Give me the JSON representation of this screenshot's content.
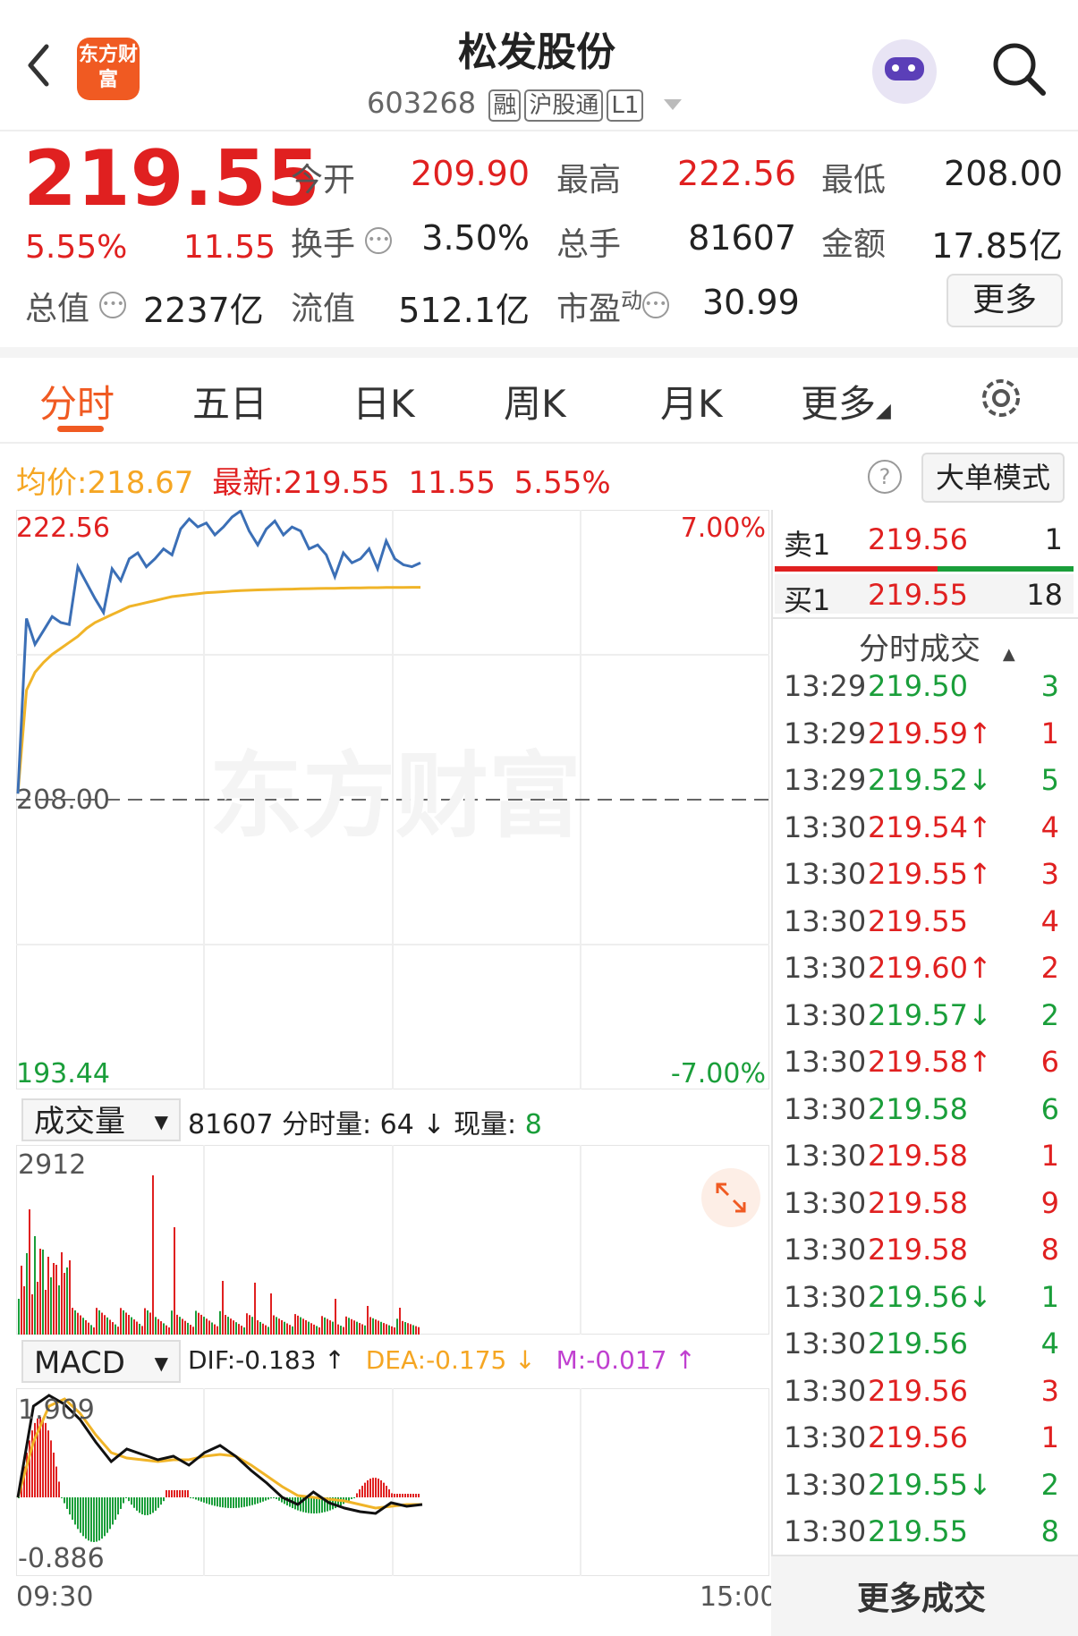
{
  "header": {
    "title": "松发股份",
    "code": "603268",
    "tags": [
      "融",
      "沪股通",
      "L1"
    ],
    "logo_text": "东方财富"
  },
  "quote": {
    "price": "219.55",
    "change_pct": "5.55%",
    "change": "11.55",
    "open_label": "今开",
    "open": "209.90",
    "high_label": "最高",
    "high": "222.56",
    "low_label": "最低",
    "low": "208.00",
    "turnover_label": "换手",
    "turnover": "3.50%",
    "volume_label": "总手",
    "volume": "81607",
    "amount_label": "金额",
    "amount": "17.85亿",
    "mktcap_label": "总值",
    "mktcap": "2237亿",
    "float_label": "流值",
    "float": "512.1亿",
    "pe_label": "市盈",
    "pe_sup": "动",
    "pe": "30.99",
    "more_label": "更多"
  },
  "tabs": [
    "分时",
    "五日",
    "日K",
    "周K",
    "月K",
    "更多"
  ],
  "info_bar": {
    "avg_label": "均价:",
    "avg": "218.67",
    "latest_label": "最新:",
    "latest": "219.55",
    "chg": "11.55",
    "pct": "5.55%",
    "mode_button": "大单模式"
  },
  "price_chart": {
    "y_top": "222.56",
    "y_mid": "208.00",
    "y_bottom": "193.44",
    "pct_top": "7.00%",
    "pct_bottom": "-7.00%",
    "watermark": "东方财富"
  },
  "volume_panel": {
    "selector": "成交量",
    "total": "81607",
    "minute_label": "分时量:",
    "minute": "64",
    "current_label": "现量:",
    "current": "8",
    "y_max": "2912"
  },
  "macd_panel": {
    "selector": "MACD",
    "dif": "DIF:-0.183 ↑",
    "dea": "DEA:-0.175 ↓",
    "m": "M:-0.017 ↑",
    "y_top": "1.909",
    "y_bottom": "-0.886",
    "x_start": "09:30",
    "x_end": "15:00"
  },
  "order_book": {
    "sell_label": "卖1",
    "sell_price": "219.56",
    "sell_qty": "1",
    "buy_label": "买1",
    "buy_price": "219.55",
    "buy_qty": "18"
  },
  "trades_header": "分时成交",
  "trades": [
    {
      "time": "13:29",
      "price": "219.50",
      "arrow": "",
      "qty": "3",
      "color": "green"
    },
    {
      "time": "13:29",
      "price": "219.59",
      "arrow": "↑",
      "qty": "1",
      "color": "red"
    },
    {
      "time": "13:29",
      "price": "219.52",
      "arrow": "↓",
      "qty": "5",
      "color": "green"
    },
    {
      "time": "13:30",
      "price": "219.54",
      "arrow": "↑",
      "qty": "4",
      "color": "red"
    },
    {
      "time": "13:30",
      "price": "219.55",
      "arrow": "↑",
      "qty": "3",
      "color": "red"
    },
    {
      "time": "13:30",
      "price": "219.55",
      "arrow": "",
      "qty": "4",
      "color": "red"
    },
    {
      "time": "13:30",
      "price": "219.60",
      "arrow": "↑",
      "qty": "2",
      "color": "red"
    },
    {
      "time": "13:30",
      "price": "219.57",
      "arrow": "↓",
      "qty": "2",
      "color": "green"
    },
    {
      "time": "13:30",
      "price": "219.58",
      "arrow": "↑",
      "qty": "6",
      "color": "red"
    },
    {
      "time": "13:30",
      "price": "219.58",
      "arrow": "",
      "qty": "6",
      "color": "green"
    },
    {
      "time": "13:30",
      "price": "219.58",
      "arrow": "",
      "qty": "1",
      "color": "red"
    },
    {
      "time": "13:30",
      "price": "219.58",
      "arrow": "",
      "qty": "9",
      "color": "red"
    },
    {
      "time": "13:30",
      "price": "219.58",
      "arrow": "",
      "qty": "8",
      "color": "red"
    },
    {
      "time": "13:30",
      "price": "219.56",
      "arrow": "↓",
      "qty": "1",
      "color": "green"
    },
    {
      "time": "13:30",
      "price": "219.56",
      "arrow": "",
      "qty": "4",
      "color": "green"
    },
    {
      "time": "13:30",
      "price": "219.56",
      "arrow": "",
      "qty": "3",
      "color": "red"
    },
    {
      "time": "13:30",
      "price": "219.56",
      "arrow": "",
      "qty": "1",
      "color": "red"
    },
    {
      "time": "13:30",
      "price": "219.55",
      "arrow": "↓",
      "qty": "2",
      "color": "green"
    },
    {
      "time": "13:30",
      "price": "219.55",
      "arrow": "",
      "qty": "8",
      "color": "green"
    }
  ],
  "trades_footer": "更多成交",
  "colors": {
    "up": "#e02020",
    "down": "#1a9e3a",
    "price_line": "#3b6fb6",
    "avg_line": "#f0b428",
    "accent": "#f05a22"
  },
  "chart_data": {
    "type": "line",
    "series": [
      {
        "values": [
          208.3,
          217.1,
          215.8,
          216.5,
          217.2,
          216.9,
          216.8,
          219.7,
          218.9,
          218.1,
          217.4,
          219.6,
          219.0,
          220.1,
          220.4,
          219.7,
          220.1,
          220.6,
          220.3,
          221.6,
          222.1,
          221.7,
          221.9,
          221.3,
          221.7,
          222.2,
          222.5,
          221.5,
          220.8,
          221.6,
          222.0,
          221.3,
          221.7,
          221.5,
          220.6,
          220.8,
          220.3,
          219.2,
          220.4,
          219.9,
          220.1,
          220.6,
          219.6,
          221.0,
          220.1,
          219.8,
          219.7,
          219.9
        ]
      },
      {
        "values": [
          208.3,
          213.5,
          214.4,
          214.9,
          215.3,
          215.6,
          215.9,
          216.2,
          216.6,
          216.9,
          217.1,
          217.3,
          217.5,
          217.7,
          217.8,
          217.9,
          218.0,
          218.1,
          218.2,
          218.25,
          218.3,
          218.35,
          218.4,
          218.42,
          218.45,
          218.48,
          218.5,
          218.52,
          218.54,
          218.55,
          218.56,
          218.57,
          218.58,
          218.59,
          218.6,
          218.61,
          218.62,
          218.62,
          218.63,
          218.64,
          218.64,
          218.65,
          218.65,
          218.66,
          218.66,
          218.66,
          218.67,
          218.67
        ]
      }
    ],
    "ylim": [
      193.44,
      222.56
    ],
    "x_range": [
      "09:30",
      "15:00"
    ]
  }
}
